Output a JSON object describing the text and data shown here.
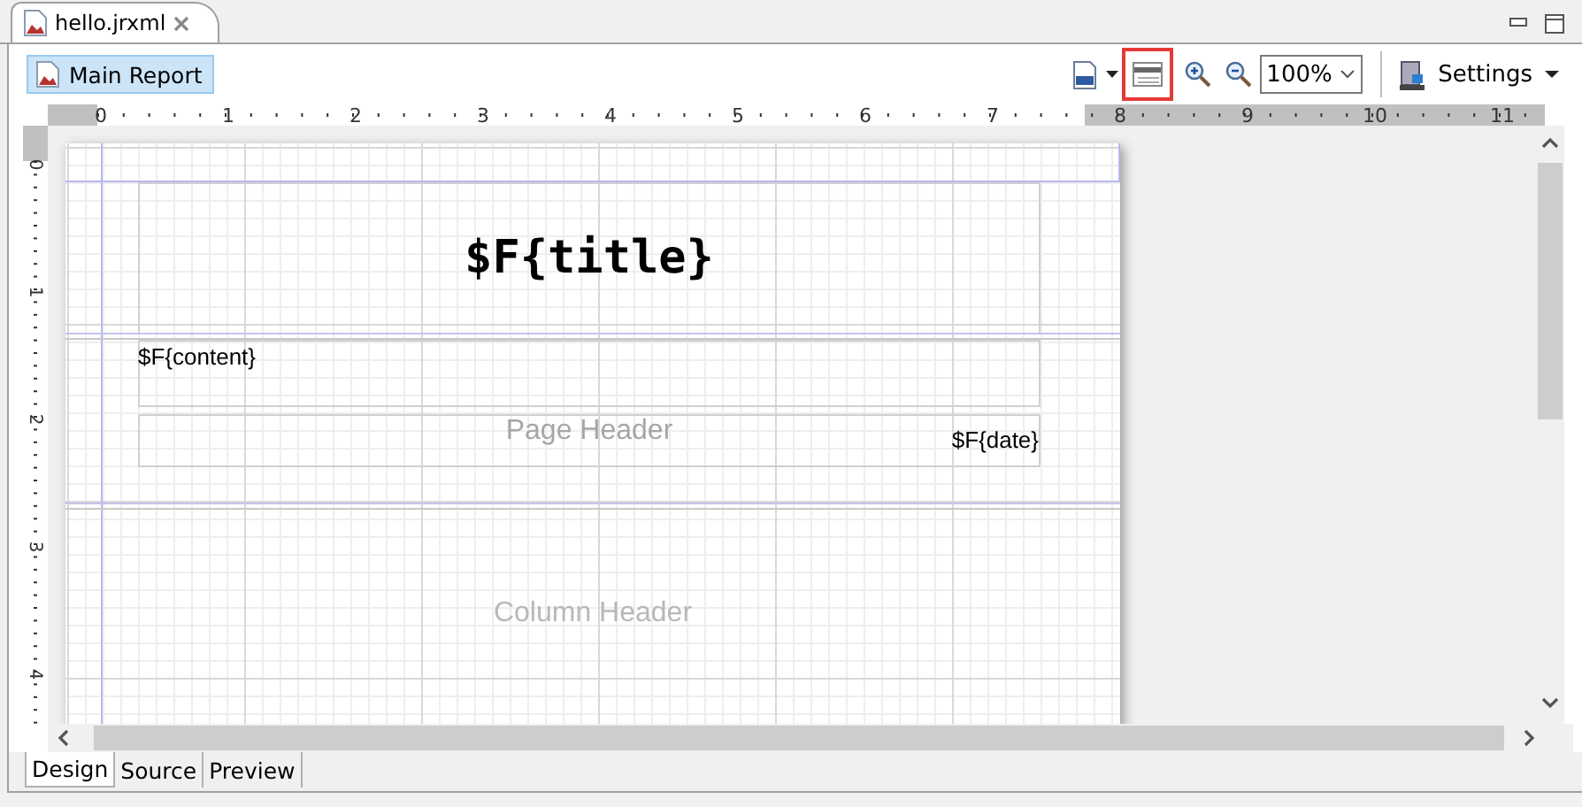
{
  "editor_tab": {
    "title": "hello.jrxml"
  },
  "toolbar": {
    "report_button": "Main Report",
    "layout_tool": {
      "highlighted": true
    },
    "zoom": "100%",
    "settings": "Settings"
  },
  "ruler": {
    "horizontal": [
      "0",
      "1",
      "2",
      "3",
      "4",
      "5",
      "6",
      "7",
      "8",
      "9",
      "10",
      "11"
    ],
    "vertical": [
      "0",
      "1",
      "2",
      "3",
      "4"
    ]
  },
  "report": {
    "title_field": "$F{title}",
    "page_header": {
      "label": "Page Header",
      "content_field": "$F{content}",
      "date_field": "$F{date}"
    },
    "column_header": {
      "label": "Column Header"
    }
  },
  "bottom_tabs": [
    {
      "label": "Design",
      "selected": true
    },
    {
      "label": "Source",
      "selected": false
    },
    {
      "label": "Preview",
      "selected": false
    }
  ]
}
